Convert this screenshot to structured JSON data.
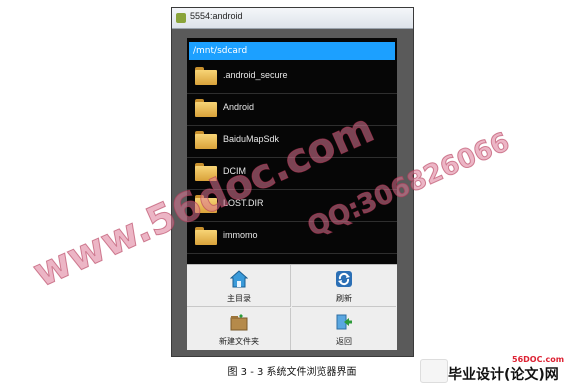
{
  "window": {
    "title": "5554:android"
  },
  "browser": {
    "path": "/mnt/sdcard",
    "files": [
      {
        "name": ".android_secure",
        "icon": "folder-icon"
      },
      {
        "name": "Android",
        "icon": "folder-icon"
      },
      {
        "name": "BaiduMapSdk",
        "icon": "folder-icon"
      },
      {
        "name": "DCIM",
        "icon": "folder-icon"
      },
      {
        "name": "LOST.DIR",
        "icon": "folder-icon"
      },
      {
        "name": "immomo",
        "icon": "folder-icon"
      }
    ]
  },
  "menu": {
    "items": [
      {
        "label": "主目录",
        "icon": "home-icon"
      },
      {
        "label": "刷新",
        "icon": "refresh-icon"
      },
      {
        "label": "新建文件夹",
        "icon": "new-folder-icon"
      },
      {
        "label": "返回",
        "icon": "back-icon"
      }
    ]
  },
  "caption": "图 3 - 3  系统文件浏览器界面",
  "watermarks": {
    "left": "www.56doc.com",
    "right": "QQ:306826066"
  },
  "footer": {
    "site": "56DOC.com",
    "brand": "毕业设计(论文)网"
  },
  "colors": {
    "path_bar": "#1ca0ff",
    "screen_bg": "#060606",
    "menu_bg": "#eeeeee",
    "watermark": "#dc7896"
  }
}
